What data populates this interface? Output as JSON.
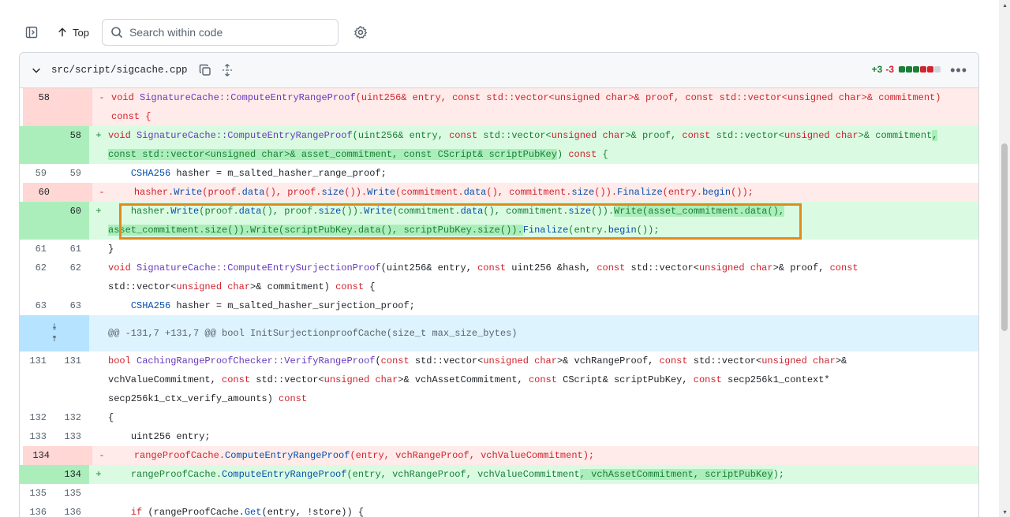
{
  "toolbar": {
    "top_label": "Top",
    "search_placeholder": "Search within code"
  },
  "file": {
    "path": "src/script/sigcache.cpp",
    "additions": "+3",
    "deletions": "-3",
    "diffstat_blocks": [
      "#1a7f37",
      "#1a7f37",
      "#1a7f37",
      "#d1242f",
      "#d1242f",
      "#d0d7de"
    ]
  },
  "hunk_header": "@@ -131,7 +131,7 @@ bool InitSurjectionproofCache(size_t max_size_bytes)",
  "lines": [
    {
      "type": "del",
      "old": "58",
      "new": "",
      "sign": "-",
      "segs": [
        [
          "kw",
          "void "
        ],
        [
          "fn",
          "SignatureCache::ComputeEntryRangeProof"
        ],
        [
          "",
          "(uint256& entry, "
        ],
        [
          "kw",
          "const"
        ],
        [
          "",
          " std::vector<"
        ],
        [
          "kw",
          "unsigned char"
        ],
        [
          "",
          ">& proof, "
        ],
        [
          "kw",
          "const"
        ],
        [
          "",
          " std::vector<"
        ],
        [
          "kw",
          "unsigned char"
        ],
        [
          "",
          ">& commitment)\n"
        ],
        [
          "kw",
          "const"
        ],
        [
          "",
          " {"
        ]
      ]
    },
    {
      "type": "add",
      "old": "",
      "new": "58",
      "sign": "+",
      "segs": [
        [
          "kw",
          "void "
        ],
        [
          "fn",
          "SignatureCache::ComputeEntryRangeProof"
        ],
        [
          "",
          "(uint256& entry, "
        ],
        [
          "kw",
          "const"
        ],
        [
          "",
          " std::vector<"
        ],
        [
          "kw",
          "unsigned char"
        ],
        [
          "",
          ">& proof, "
        ],
        [
          "kw",
          "const"
        ],
        [
          "",
          " std::vector<"
        ],
        [
          "kw",
          "unsigned char"
        ],
        [
          "",
          ">& commitment"
        ],
        [
          "hl",
          ",\nconst std::vector<unsigned char>& asset_commitment, const CScript& scriptPubKey"
        ],
        [
          "",
          ") "
        ],
        [
          "kw",
          "const"
        ],
        [
          "",
          " {"
        ]
      ]
    },
    {
      "type": "ctx",
      "old": "59",
      "new": "59",
      "sign": "",
      "segs": [
        [
          "",
          "    "
        ],
        [
          "mt",
          "CSHA256"
        ],
        [
          "",
          " hasher = m_salted_hasher_range_proof;"
        ]
      ]
    },
    {
      "type": "del",
      "old": "60",
      "new": "",
      "sign": "-",
      "segs": [
        [
          "",
          "    hasher."
        ],
        [
          "mt",
          "Write"
        ],
        [
          "",
          "(proof."
        ],
        [
          "mt",
          "data"
        ],
        [
          "",
          "(), proof."
        ],
        [
          "mt",
          "size"
        ],
        [
          "",
          "())."
        ],
        [
          "mt",
          "Write"
        ],
        [
          "",
          "(commitment."
        ],
        [
          "mt",
          "data"
        ],
        [
          "",
          "(), commitment."
        ],
        [
          "mt",
          "size"
        ],
        [
          "",
          "())."
        ],
        [
          "mt",
          "Finalize"
        ],
        [
          "",
          "(entry."
        ],
        [
          "mt",
          "begin"
        ],
        [
          "",
          "());"
        ]
      ]
    },
    {
      "type": "add",
      "old": "",
      "new": "60",
      "sign": "+",
      "segs": [
        [
          "",
          "    hasher."
        ],
        [
          "mt",
          "Write"
        ],
        [
          "",
          "(proof."
        ],
        [
          "mt",
          "data"
        ],
        [
          "",
          "(), proof."
        ],
        [
          "mt",
          "size"
        ],
        [
          "",
          "())."
        ],
        [
          "mt",
          "Write"
        ],
        [
          "",
          "(commitment."
        ],
        [
          "mt",
          "data"
        ],
        [
          "",
          "(), commitment."
        ],
        [
          "mt",
          "size"
        ],
        [
          "",
          "())."
        ],
        [
          "hl",
          "Write(asset_commitment.data(),\nasset_commitment.size()).Write(scriptPubKey.data(), scriptPubKey.size())."
        ],
        [
          "mt",
          "Finalize"
        ],
        [
          "",
          "(entry."
        ],
        [
          "mt",
          "begin"
        ],
        [
          "",
          "());"
        ]
      ]
    },
    {
      "type": "ctx",
      "old": "61",
      "new": "61",
      "sign": "",
      "segs": [
        [
          "",
          "}"
        ]
      ]
    },
    {
      "type": "ctx",
      "old": "62",
      "new": "62",
      "sign": "",
      "segs": [
        [
          "kw",
          "void "
        ],
        [
          "fn",
          "SignatureCache::ComputeEntrySurjectionProof"
        ],
        [
          "",
          "(uint256& entry, "
        ],
        [
          "kw",
          "const"
        ],
        [
          "",
          " uint256 &hash, "
        ],
        [
          "kw",
          "const"
        ],
        [
          "",
          " std::vector<"
        ],
        [
          "kw",
          "unsigned char"
        ],
        [
          "",
          ">& proof, "
        ],
        [
          "kw",
          "const"
        ],
        [
          "",
          "\nstd::vector<"
        ],
        [
          "kw",
          "unsigned char"
        ],
        [
          "",
          ">& commitment) "
        ],
        [
          "kw",
          "const"
        ],
        [
          "",
          " {"
        ]
      ]
    },
    {
      "type": "ctx",
      "old": "63",
      "new": "63",
      "sign": "",
      "segs": [
        [
          "",
          "    "
        ],
        [
          "mt",
          "CSHA256"
        ],
        [
          "",
          " hasher = m_salted_hasher_surjection_proof;"
        ]
      ]
    },
    {
      "type": "hunk"
    },
    {
      "type": "ctx",
      "old": "131",
      "new": "131",
      "sign": "",
      "segs": [
        [
          "kw",
          "bool "
        ],
        [
          "fn",
          "CachingRangeProofChecker::VerifyRangeProof"
        ],
        [
          "",
          "("
        ],
        [
          "kw",
          "const"
        ],
        [
          "",
          " std::vector<"
        ],
        [
          "kw",
          "unsigned char"
        ],
        [
          "",
          ">& vchRangeProof, "
        ],
        [
          "kw",
          "const"
        ],
        [
          "",
          " std::vector<"
        ],
        [
          "kw",
          "unsigned char"
        ],
        [
          "",
          ">&\nvchValueCommitment, "
        ],
        [
          "kw",
          "const"
        ],
        [
          "",
          " std::vector<"
        ],
        [
          "kw",
          "unsigned char"
        ],
        [
          "",
          ">& vchAssetCommitment, "
        ],
        [
          "kw",
          "const"
        ],
        [
          "",
          " CScript& scriptPubKey, "
        ],
        [
          "kw",
          "const"
        ],
        [
          "",
          " secp256k1_context*\nsecp256k1_ctx_verify_amounts) "
        ],
        [
          "kw",
          "const"
        ]
      ]
    },
    {
      "type": "ctx",
      "old": "132",
      "new": "132",
      "sign": "",
      "segs": [
        [
          "",
          "{"
        ]
      ]
    },
    {
      "type": "ctx",
      "old": "133",
      "new": "133",
      "sign": "",
      "segs": [
        [
          "",
          "    uint256 entry;"
        ]
      ]
    },
    {
      "type": "del",
      "old": "134",
      "new": "",
      "sign": "-",
      "segs": [
        [
          "",
          "    rangeProofCache."
        ],
        [
          "mt",
          "ComputeEntryRangeProof"
        ],
        [
          "",
          "(entry, vchRangeProof, vchValueCommitment);"
        ]
      ]
    },
    {
      "type": "add",
      "old": "",
      "new": "134",
      "sign": "+",
      "segs": [
        [
          "",
          "    rangeProofCache."
        ],
        [
          "mt",
          "ComputeEntryRangeProof"
        ],
        [
          "",
          "(entry, vchRangeProof, vchValueCommitment"
        ],
        [
          "hl",
          ", vchAssetCommitment, scriptPubKey"
        ],
        [
          "",
          ");"
        ]
      ]
    },
    {
      "type": "ctx",
      "old": "135",
      "new": "135",
      "sign": "",
      "segs": [
        [
          "",
          ""
        ]
      ]
    },
    {
      "type": "ctx",
      "old": "136",
      "new": "136",
      "sign": "",
      "segs": [
        [
          "",
          "    "
        ],
        [
          "kw",
          "if"
        ],
        [
          "",
          " (rangeProofCache."
        ],
        [
          "mt",
          "Get"
        ],
        [
          "",
          "(entry, !store)) {"
        ]
      ]
    }
  ]
}
